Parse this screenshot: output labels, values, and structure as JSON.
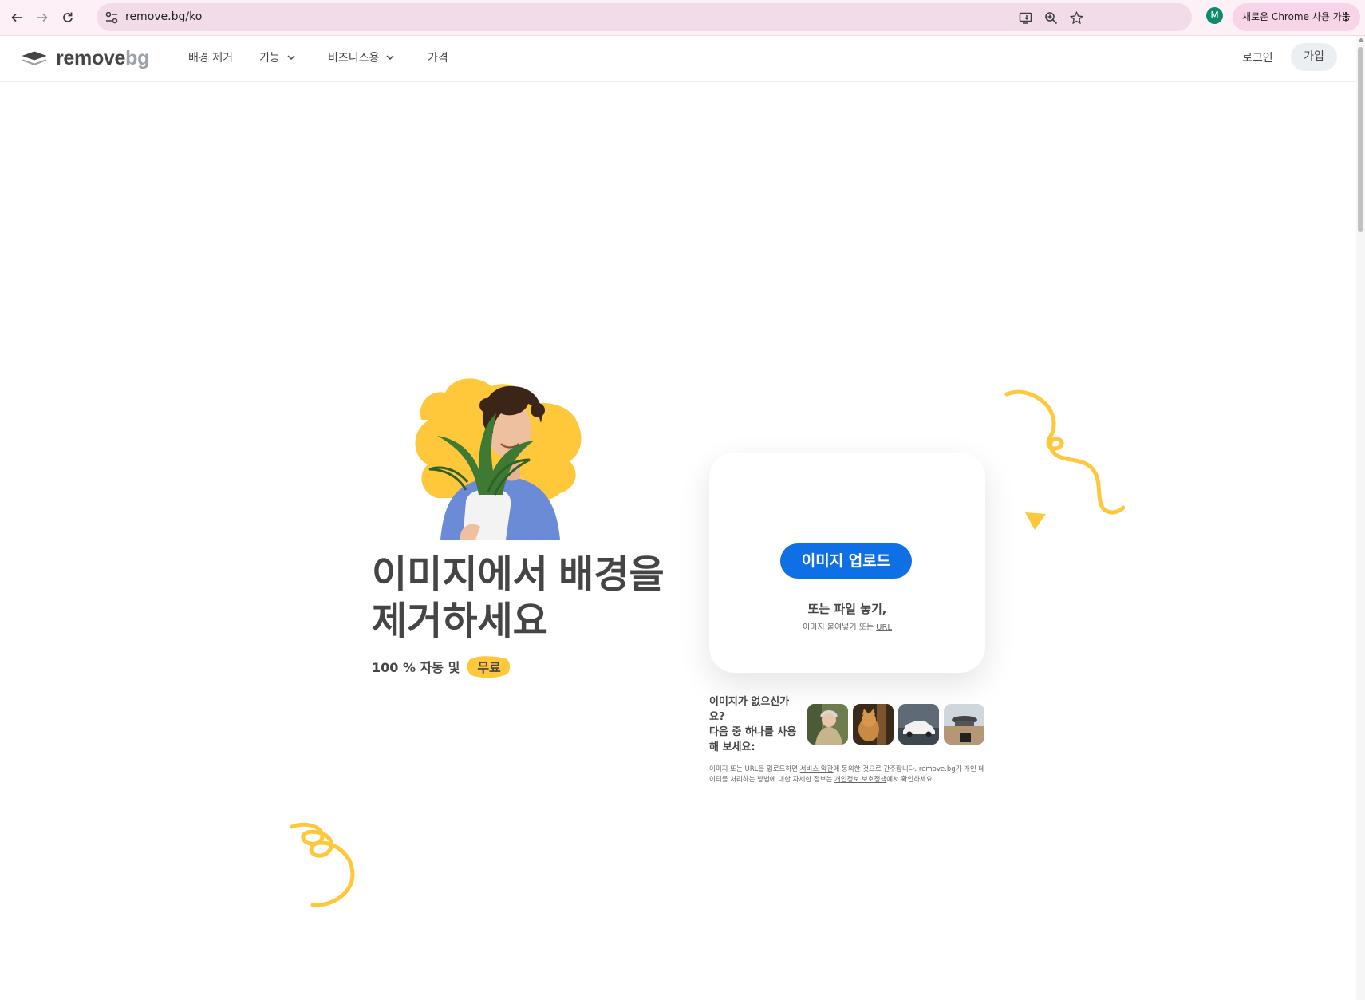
{
  "browser": {
    "url": "remove.bg/ko",
    "profile_initial": "M",
    "update_chip_label": "새로운 Chrome 사용 가능"
  },
  "header": {
    "logo_main": "remove",
    "logo_accent": "bg",
    "menu": [
      {
        "label": "배경 제거",
        "has_dropdown": false
      },
      {
        "label": "기능",
        "has_dropdown": true
      },
      {
        "label": "비즈니스용",
        "has_dropdown": true
      },
      {
        "label": "가격",
        "has_dropdown": false
      }
    ],
    "login_label": "로그인",
    "signup_label": "가입"
  },
  "hero": {
    "title_line1": "이미지에서 배경을",
    "title_line2": "제거하세요",
    "subtitle_prefix": "100 % 자동 및",
    "subtitle_highlight": "무료"
  },
  "upload": {
    "button_label": "이미지 업로드",
    "drop_title": "또는 파일 놓기,",
    "drop_sub_prefix": "이미지 붙여넣기 또는",
    "drop_sub_url": "URL"
  },
  "samples": {
    "label_line1": "이미지가 없으신가요?",
    "label_line2": "다음 중 하나를 사용해 보세요:",
    "items": [
      "person-sample",
      "cat-sample",
      "car-sample",
      "product-sample"
    ]
  },
  "legal": {
    "part1": "이미지 또는 URL을 업로드하면 ",
    "terms_link": "서비스 약관",
    "part2": "에 동의한 것으로 간주합니다. remove.bg가 개인 데이터를 처리하는 방법에 대한 자세한 정보는 ",
    "privacy_link": "개인정보 보호정책",
    "part3": "에서 확인하세요."
  },
  "colors": {
    "accent_yellow": "#ffc83a",
    "primary_blue": "#0f70e6",
    "text_dark": "#454545",
    "chrome_bg": "#fdf0f7"
  }
}
